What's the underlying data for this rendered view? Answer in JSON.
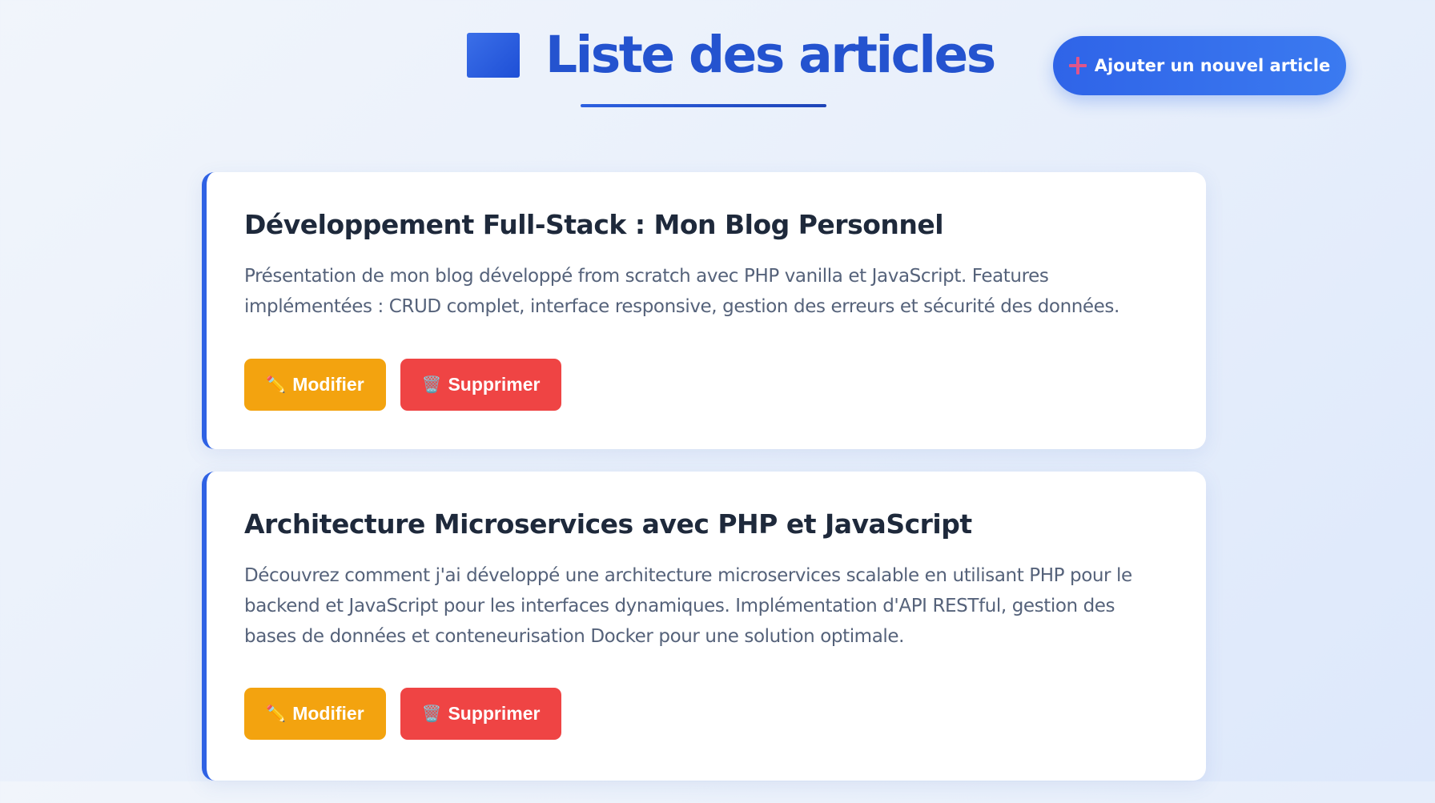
{
  "header": {
    "title": "Liste des articles",
    "title_icon": "blue-square-icon",
    "add_button_label": "Ajouter un nouvel article",
    "add_button_icon": "plus-icon"
  },
  "articles": [
    {
      "title": "Développement Full-Stack : Mon Blog Personnel",
      "description": "Présentation de mon blog développé from scratch avec PHP vanilla et JavaScript. Features implémentées : CRUD complet, interface responsive, gestion des erreurs et sécurité des données.",
      "edit_label": "Modifier",
      "delete_label": "Supprimer"
    },
    {
      "title": "Architecture Microservices avec PHP et JavaScript",
      "description": "Découvrez comment j'ai développé une architecture microservices scalable en utilisant PHP pour le backend et JavaScript pour les interfaces dynamiques. Implémentation d'API RESTful, gestion des bases de données et conteneurisation Docker pour une solution optimale.",
      "edit_label": "Modifier",
      "delete_label": "Supprimer"
    }
  ],
  "icons": {
    "edit": "pencil-icon",
    "delete": "wastebasket-icon"
  },
  "colors": {
    "accent": "#2453cf",
    "primary_button": "#3b7af0",
    "edit_button": "#f3a30f",
    "delete_button": "#ef4444",
    "card_border": "#2f62e4"
  }
}
